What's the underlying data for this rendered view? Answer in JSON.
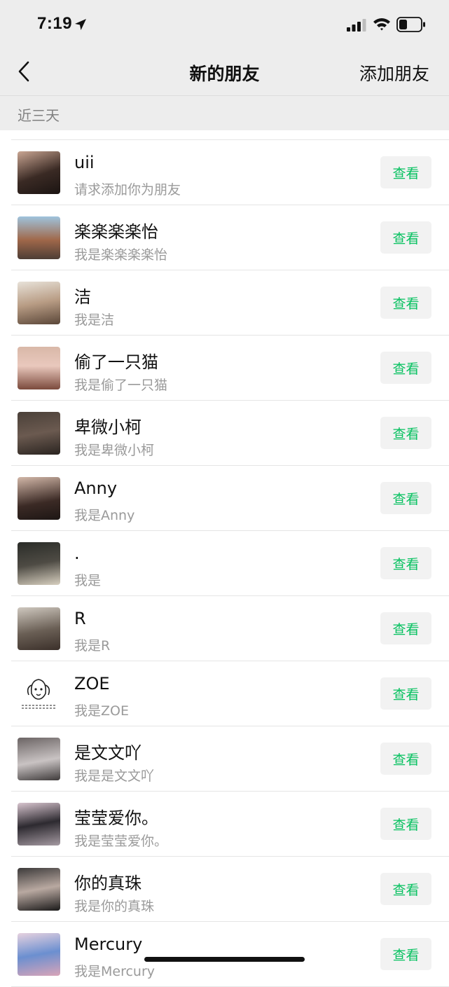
{
  "status_bar": {
    "time": "7:19"
  },
  "nav": {
    "title": "新的朋友",
    "add_friend": "添加朋友"
  },
  "section": {
    "label": "近三天"
  },
  "colors": {
    "accent_green": "#07c160",
    "background_gray": "#ededed",
    "button_gray": "#f2f2f2"
  },
  "requests": [
    {
      "name": "uii",
      "message": "请求添加你为朋友",
      "button": "查看"
    },
    {
      "name": "楽楽楽楽怡",
      "message": "我是楽楽楽楽怡",
      "button": "查看"
    },
    {
      "name": "洁",
      "message": "我是洁",
      "button": "查看"
    },
    {
      "name": "偷了一只猫",
      "message": "我是偷了一只猫",
      "button": "查看"
    },
    {
      "name": "卑微小柯",
      "message": "我是卑微小柯",
      "button": "查看"
    },
    {
      "name": "Anny",
      "message": "我是Anny",
      "button": "查看"
    },
    {
      "name": ".",
      "message": "我是",
      "button": "查看"
    },
    {
      "name": "R",
      "message": "我是R",
      "button": "查看"
    },
    {
      "name": "ZOE",
      "message": "我是ZOE",
      "button": "查看"
    },
    {
      "name": "是文文吖",
      "message": "我是是文文吖",
      "button": "查看"
    },
    {
      "name": "莹莹爱你。",
      "message": "我是莹莹爱你。",
      "button": "查看"
    },
    {
      "name": "你的真珠",
      "message": "我是你的真珠",
      "button": "查看"
    },
    {
      "name": "Mercury",
      "message": "我是Mercury",
      "button": "查看"
    }
  ]
}
